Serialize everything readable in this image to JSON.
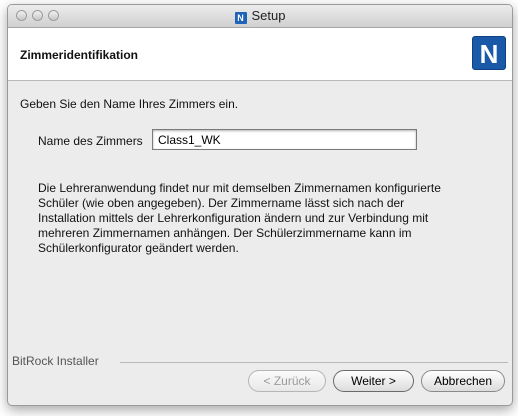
{
  "window": {
    "title": "Setup",
    "app_icon_letter": "N"
  },
  "header": {
    "title": "Zimmeridentifikation",
    "logo_letter": "N"
  },
  "main": {
    "instruction": "Geben Sie den Name Ihres Zimmers ein.",
    "field_label": "Name des Zimmers",
    "room_name_value": "Class1_WK",
    "description": "Die Lehreranwendung findet nur mit demselben Zimmernamen konfigurierte\nSchüler (wie oben angegeben). Der Zimmername lässt sich nach der\nInstallation mittels der Lehrerkonfiguration ändern und zur Verbindung mit\nmehreren Zimmernamen anhängen. Der Schülerzimmername kann im\nSchülerkonfigurator geändert werden."
  },
  "footer": {
    "installer_label": "BitRock Installer",
    "back_label": "< Zurück",
    "next_label": "Weiter >",
    "cancel_label": "Abbrechen"
  },
  "colors": {
    "logo_blue": "#1a58a8",
    "window_bg": "#ececec",
    "header_bg": "#ffffff"
  }
}
